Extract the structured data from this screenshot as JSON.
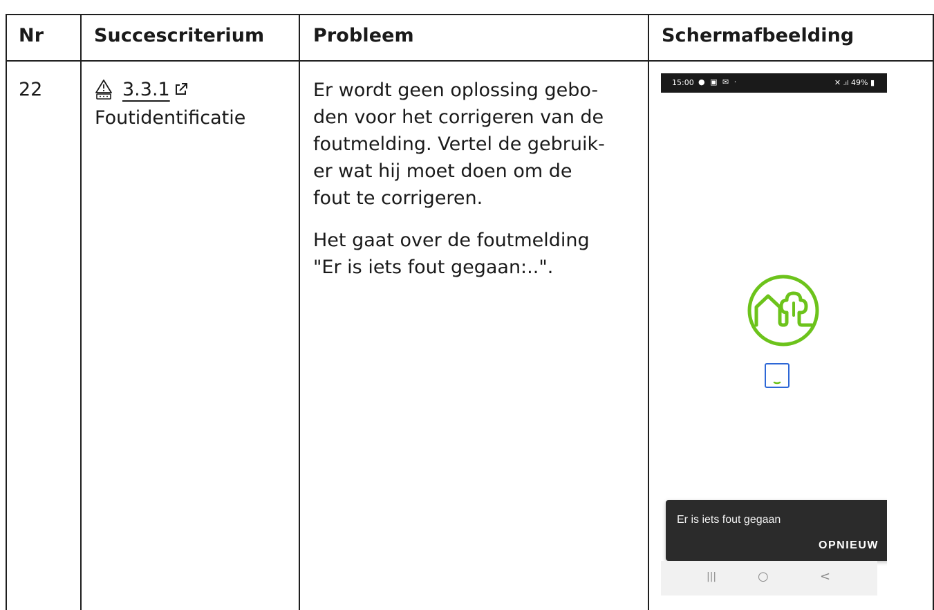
{
  "table": {
    "headers": {
      "nr": "Nr",
      "criterion": "Succescriterium",
      "problem": "Probleem",
      "screenshot": "Schermafbeelding"
    },
    "row": {
      "nr": "22",
      "criterion_code": "3.3.1",
      "criterion_name": "Foutidentificatie",
      "problem_paragraphs": [
        "Er wordt geen oplossing gebo-\nden voor het corrigeren van de\nfoutmelding. Vertel de gebruik-\ner wat hij moet doen om de\nfout te corrigeren.",
        "Het gaat over de foutmelding\n\"Er is iets fout gegaan:..\"."
      ]
    }
  },
  "phone": {
    "status_time": "15:00",
    "status_right": "49%",
    "snackbar_message": "Er is iets fout gegaan",
    "snackbar_action": "OPNIEUW",
    "nav_recent": "|||",
    "nav_home": "○",
    "nav_back": "<"
  },
  "colors": {
    "logo_green": "#6cc31b",
    "spinner_blue": "#2d67d6",
    "snackbar_bg": "#2b2b2b"
  }
}
